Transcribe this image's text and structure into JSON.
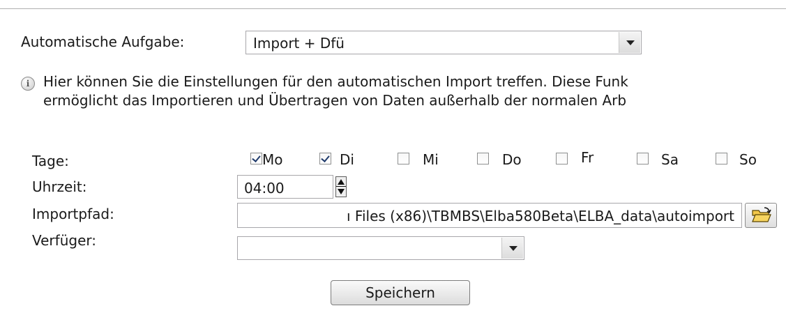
{
  "task": {
    "label": "Automatische Aufgabe:",
    "selected": "Import + Dfü"
  },
  "info": {
    "icon": "info-icon",
    "line1": "Hier können Sie die Einstellungen für den automatischen Import treffen. Diese Funk",
    "line2": "ermöglicht das Importieren und Übertragen von Daten außerhalb der normalen Arb"
  },
  "days": {
    "label": "Tage:",
    "items": [
      {
        "label": "Mo",
        "checked": true
      },
      {
        "label": "Di",
        "checked": true
      },
      {
        "label": "Mi",
        "checked": false
      },
      {
        "label": "Do",
        "checked": false
      },
      {
        "label": "Fr",
        "checked": false
      },
      {
        "label": "Sa",
        "checked": false
      },
      {
        "label": "So",
        "checked": false
      }
    ]
  },
  "time": {
    "label": "Uhrzeit:",
    "value": "04:00"
  },
  "import_path": {
    "label": "Importpfad:",
    "value": "ı Files (x86)\\TBMBS\\Elba580Beta\\ELBA_data\\autoimport"
  },
  "disposer": {
    "label": "Verfüger:",
    "selected": ""
  },
  "save_label": "Speichern"
}
